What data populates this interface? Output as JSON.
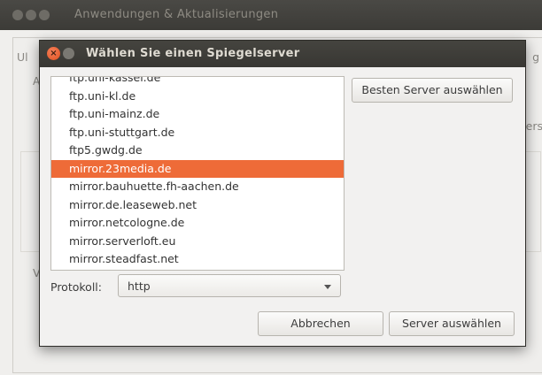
{
  "background_window": {
    "title": "Anwendungen & Aktualisierungen",
    "tab_left_fragment": "Ul",
    "tab_right_fragment": "g",
    "section_a_fragment": "A",
    "section_v_fragment": "V",
    "right_fragment": "ers"
  },
  "dialog": {
    "title": "Wählen Sie einen Spiegelserver",
    "close_glyph": "×",
    "servers": [
      "ftp.uni-kassel.de",
      "ftp.uni-kl.de",
      "ftp.uni-mainz.de",
      "ftp.uni-stuttgart.de",
      "ftp5.gwdg.de",
      "mirror.23media.de",
      "mirror.bauhuette.fh-aachen.de",
      "mirror.de.leaseweb.net",
      "mirror.netcologne.de",
      "mirror.serverloft.eu",
      "mirror.steadfast.net"
    ],
    "selected_index": 5,
    "best_server_button": "Besten Server auswählen",
    "protocol_label": "Protokoll:",
    "protocol_value": "http",
    "cancel_button": "Abbrechen",
    "select_button": "Server auswählen"
  },
  "colors": {
    "selection": "#ee6b38",
    "titlebar": "#3c3b37",
    "close_button": "#e0511f"
  }
}
